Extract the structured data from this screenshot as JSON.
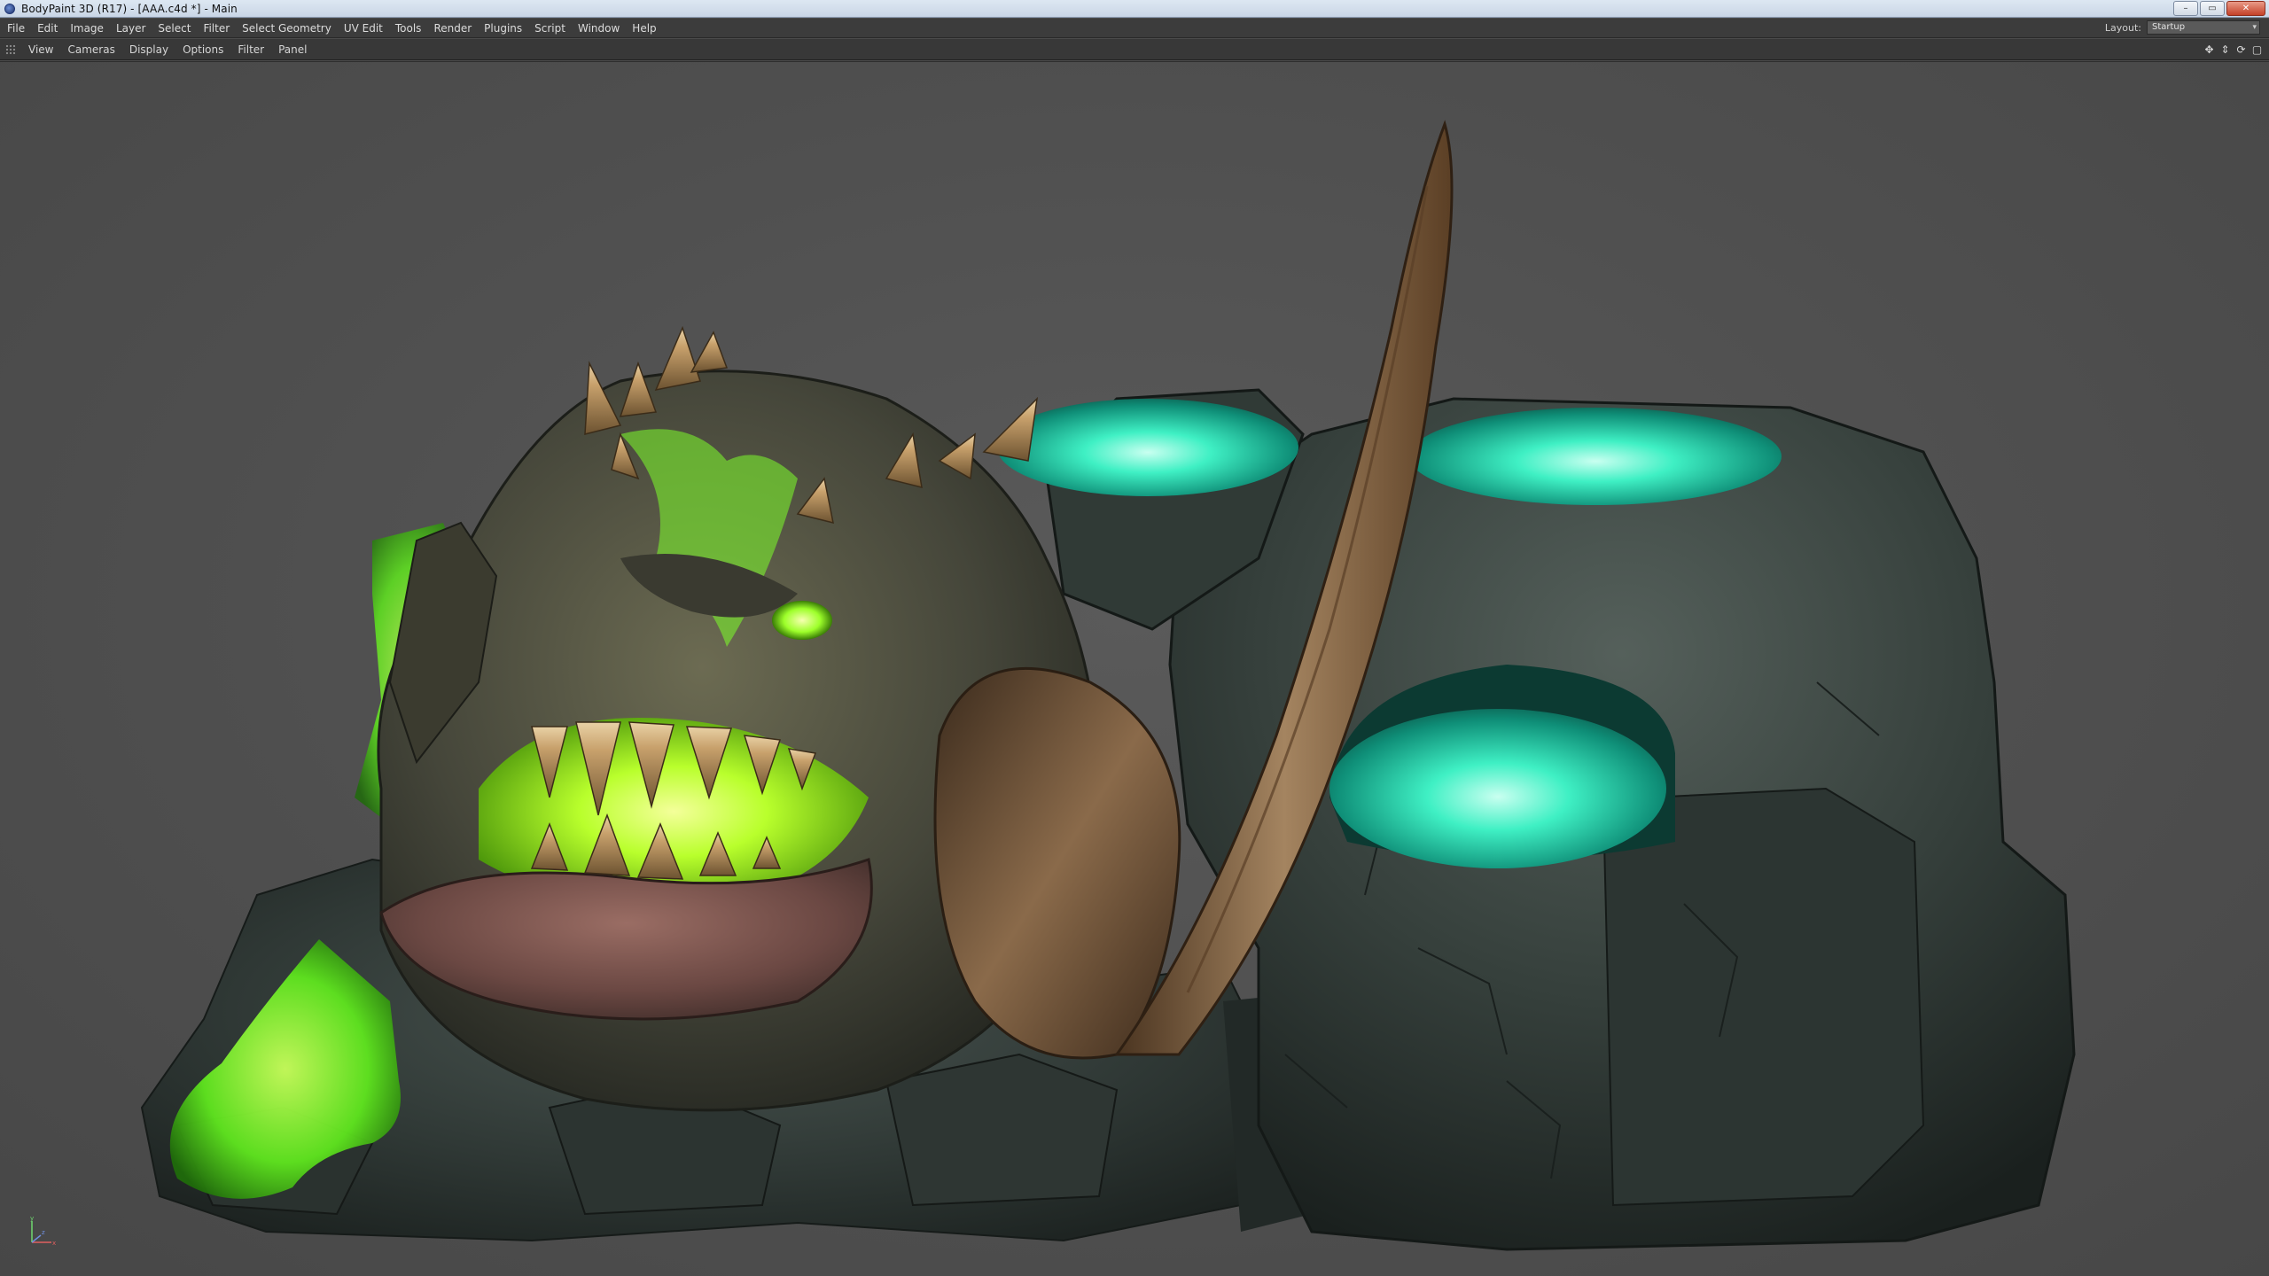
{
  "window": {
    "title": "BodyPaint 3D (R17) - [AAA.c4d *] - Main",
    "controls": {
      "minimize": "–",
      "maximize": "▭",
      "close": "✕"
    }
  },
  "menubar": {
    "items": [
      "File",
      "Edit",
      "Image",
      "Layer",
      "Select",
      "Filter",
      "Select Geometry",
      "UV Edit",
      "Tools",
      "Render",
      "Plugins",
      "Script",
      "Window",
      "Help"
    ],
    "layout_label": "Layout:",
    "layout_value": "Startup"
  },
  "viewport": {
    "menu": [
      "View",
      "Cameras",
      "Display",
      "Options",
      "Filter",
      "Panel"
    ],
    "nav_icons": [
      "move-icon",
      "zoom-icon",
      "rotate-icon",
      "maximize-view-icon"
    ],
    "axis": {
      "x": "x",
      "y": "y",
      "z": "z"
    }
  },
  "colors": {
    "viewport_bg": "#4f4f4f",
    "menu_bg": "#3c3c3c",
    "glow_green": "#7dff2a",
    "glow_teal": "#2fe8b8"
  }
}
